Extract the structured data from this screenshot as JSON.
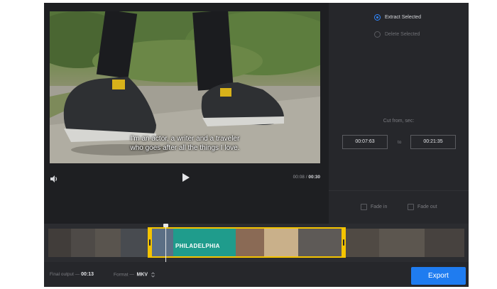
{
  "player": {
    "subtitle_line1": "I'm an actor, a writer and a traveler",
    "subtitle_line2": "who goes after all the things I love.",
    "current_time": "00:08",
    "separator": "/",
    "duration": "00:30"
  },
  "options": {
    "extract_label": "Extract Selected",
    "delete_label": "Delete Selected",
    "selected_mode": "extract"
  },
  "cut": {
    "label": "Cut from, sec:",
    "from": "00:07:63",
    "to_label": "to",
    "to": "00:21:35"
  },
  "fades": {
    "fade_in_label": "Fade in",
    "fade_out_label": "Fade out",
    "fade_in_checked": false,
    "fade_out_checked": false
  },
  "timeline": {
    "frame_overlay_text": "PHILADELPHIA",
    "selection_color": "#f5c400"
  },
  "footer": {
    "final_output_label": "Final output —",
    "final_output_value": "00:13",
    "format_label": "Format —",
    "format_value": "MKV",
    "export_label": "Export"
  },
  "colors": {
    "accent": "#1f7cf0",
    "panel": "#26272b"
  },
  "icons": [
    "volume-icon",
    "play-icon",
    "format-caret-icon"
  ]
}
